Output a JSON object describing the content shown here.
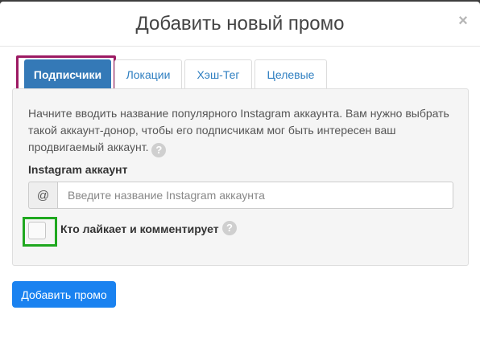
{
  "modal": {
    "title": "Добавить новый промо",
    "close_symbol": "×"
  },
  "tabs": [
    {
      "label": "Подписчики",
      "active": true
    },
    {
      "label": "Локации",
      "active": false
    },
    {
      "label": "Хэш-Тег",
      "active": false
    },
    {
      "label": "Целевые",
      "active": false
    }
  ],
  "panel": {
    "intro_text": "Начните вводить название популярного Instagram аккаунта. Вам нужно выбрать такой аккаунт-донор, чтобы его подписчикам мог быть интересен ваш продвигаемый аккаунт.",
    "help_symbol": "?",
    "field_label": "Instagram аккаунт",
    "input_addon": "@",
    "input_placeholder": "Введите название Instagram аккаунта",
    "input_value": "",
    "checkbox_label": "Кто лайкает и комментирует",
    "checkbox_checked": false
  },
  "submit_label": "Добавить промо",
  "colors": {
    "primary": "#1a82f0",
    "active_tab": "#3479b7",
    "tab_highlight": "#9c1a63",
    "checkbox_highlight": "#1fa81f"
  },
  "icons": {
    "close": "close-icon",
    "help": "question-circle-icon"
  }
}
